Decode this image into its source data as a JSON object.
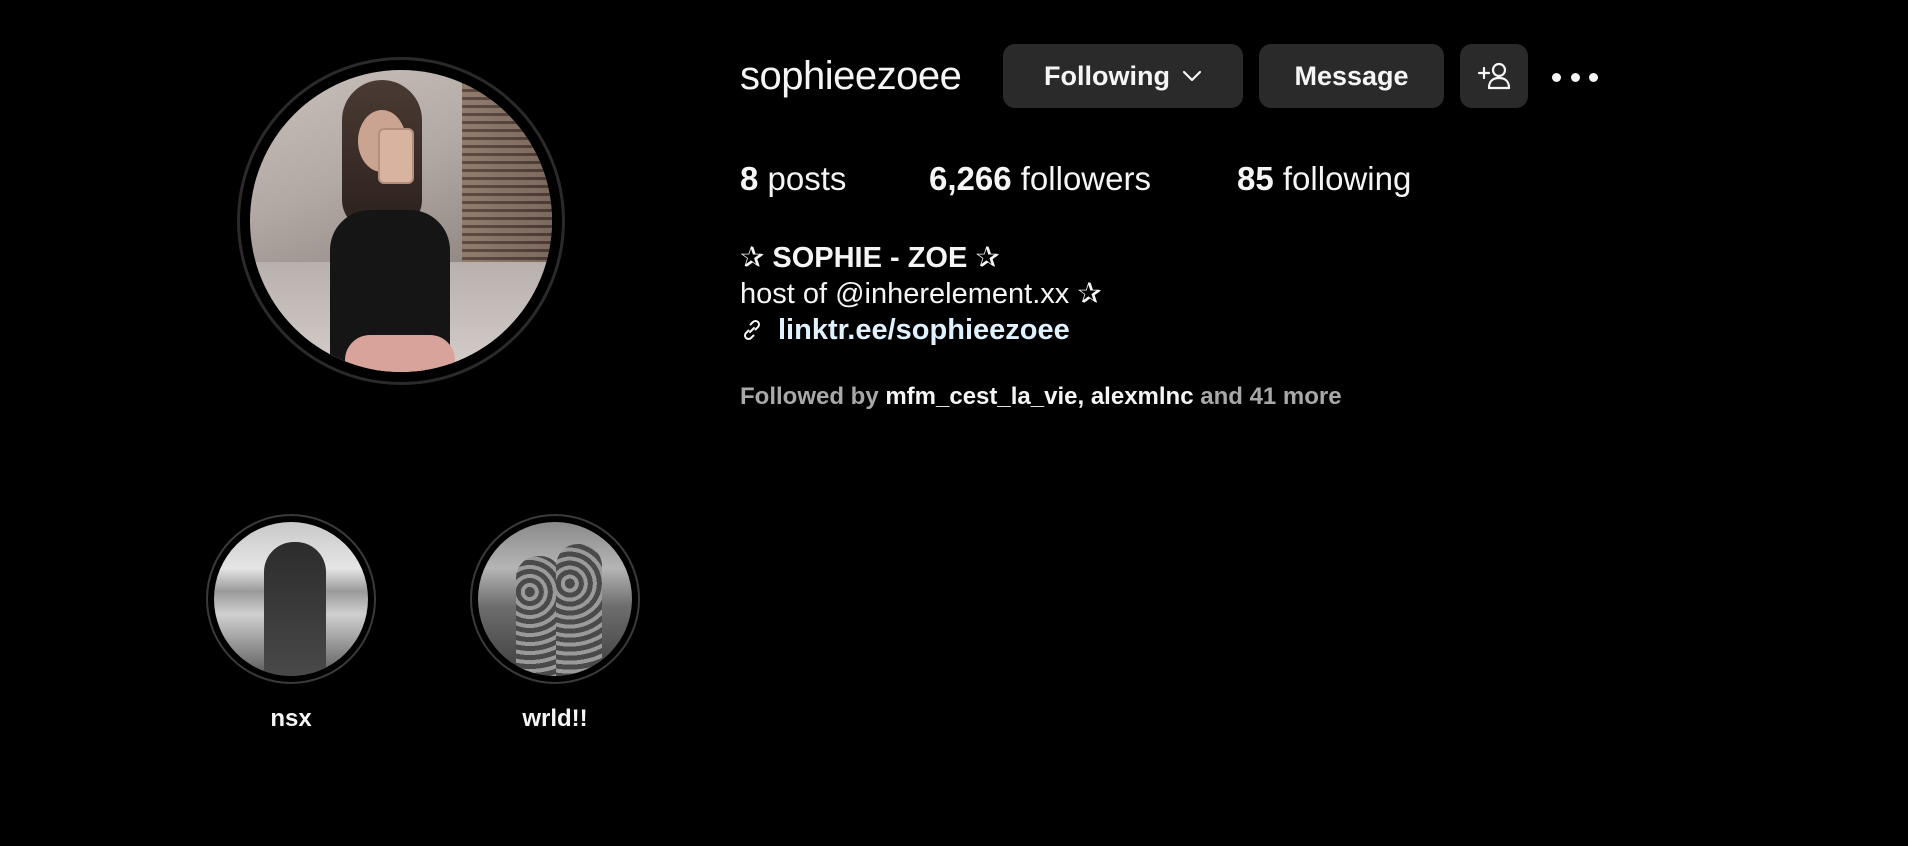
{
  "profile": {
    "username": "sophieezoee",
    "avatar_icon": "profile-photo"
  },
  "actions": {
    "following_label": "Following",
    "message_label": "Message",
    "add_user_icon": "add-user-icon",
    "more_icon": "more-options-icon"
  },
  "stats": {
    "posts_count": "8",
    "posts_label": "posts",
    "followers_count": "6,266",
    "followers_label": "followers",
    "following_count": "85",
    "following_label": "following"
  },
  "bio": {
    "name": "✰ SOPHIE - ZOE ✰",
    "line": "host of @inherelement.xx ✰",
    "link": "linktr.ee/sophieezoee"
  },
  "followed_by": {
    "prefix": "Followed by",
    "user1": "mfm_cest_la_vie",
    "separator": ",",
    "user2": "alexmlnc",
    "suffix": "and 41 more"
  },
  "highlights": [
    {
      "label": "nsx"
    },
    {
      "label": "wrld!!"
    }
  ],
  "colors": {
    "background": "#000000",
    "button_bg": "#2a2a2a",
    "text_primary": "#f5f5f5",
    "text_secondary": "#a8a8a8",
    "link": "#e0f1ff"
  }
}
